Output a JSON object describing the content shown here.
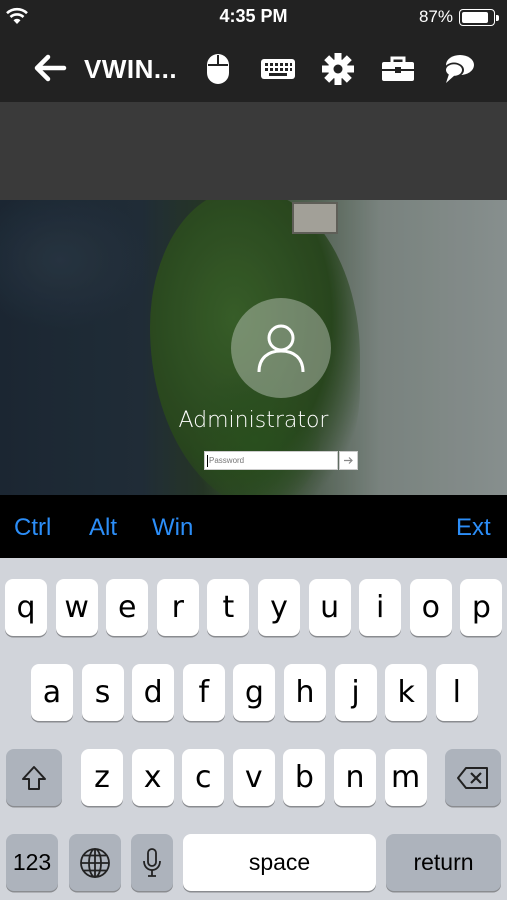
{
  "status_bar": {
    "time": "4:35 PM",
    "battery_percent": "87%",
    "battery_level": 0.87
  },
  "toolbar": {
    "title": "VWIN...",
    "icons": [
      "back-arrow-icon",
      "mouse-icon",
      "keyboard-icon",
      "gear-icon",
      "toolbox-icon",
      "chat-bubbles-icon"
    ]
  },
  "login": {
    "username": "Administrator",
    "password_placeholder": "Password"
  },
  "modifier_bar": {
    "ctrl": "Ctrl",
    "alt": "Alt",
    "win": "Win",
    "ext": "Ext"
  },
  "keyboard": {
    "row1": [
      "q",
      "w",
      "e",
      "r",
      "t",
      "y",
      "u",
      "i",
      "o",
      "p"
    ],
    "row2": [
      "a",
      "s",
      "d",
      "f",
      "g",
      "h",
      "j",
      "k",
      "l"
    ],
    "row3": [
      "z",
      "x",
      "c",
      "v",
      "b",
      "n",
      "m"
    ],
    "numbers_key": "123",
    "space_key": "space",
    "return_key": "return"
  },
  "colors": {
    "accent": "#2c8ef8",
    "toolbar_bg": "#222222",
    "keyboard_bg": "#d1d4da"
  }
}
